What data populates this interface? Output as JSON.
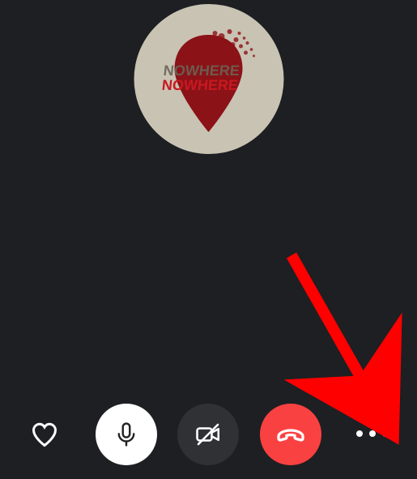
{
  "avatar": {
    "name": "Nowhere",
    "text_upper": "NOWHERE",
    "text_lower": "NOWHERE",
    "bg_color": "#c9c3b4",
    "pin_color": "#8b1217",
    "text_color": "#c0b6a0"
  },
  "controls": {
    "react_icon": "heart-icon",
    "mic": {
      "icon": "microphone-icon",
      "state": "unmuted",
      "bg": "#ffffff"
    },
    "video": {
      "icon": "video-off-icon",
      "state": "off",
      "bg": "#2f3135"
    },
    "end": {
      "icon": "hang-up-icon",
      "bg": "#fa4141"
    },
    "more_icon": "more-options-icon"
  },
  "annotation": {
    "type": "arrow",
    "color": "#ff0000",
    "target": "more-options-button"
  }
}
